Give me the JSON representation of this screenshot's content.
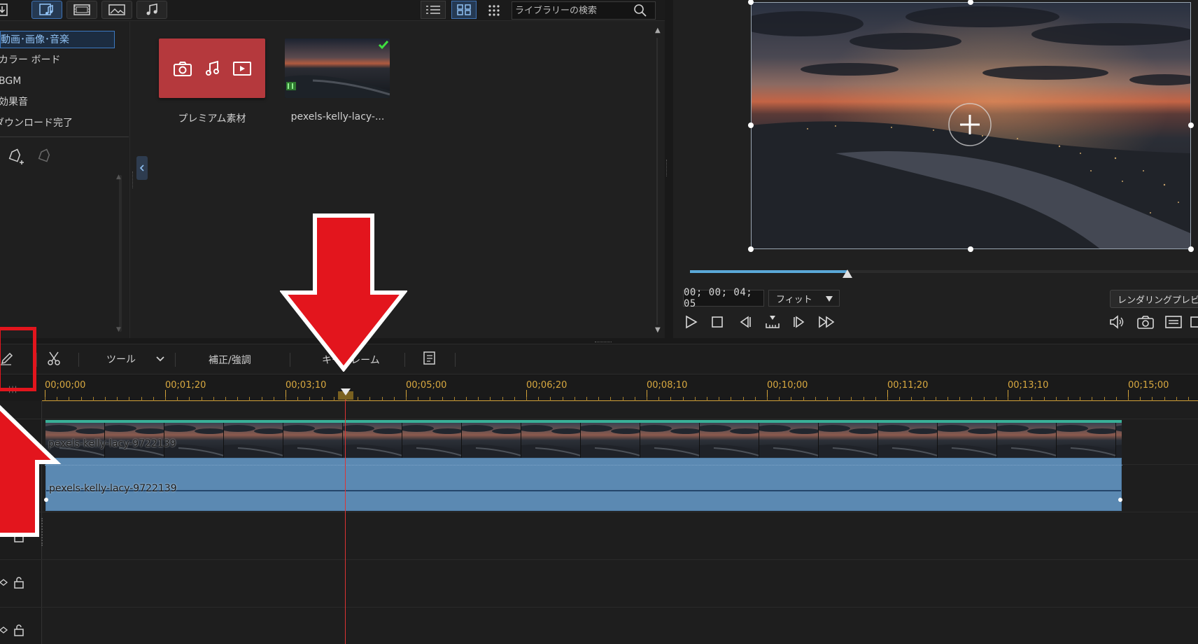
{
  "library": {
    "search_placeholder": "ライブラリーの検索",
    "categories": [
      {
        "label": "動画･画像･音楽",
        "selected": true
      },
      {
        "label": "カラー ボード",
        "selected": false
      },
      {
        "label": "BGM",
        "selected": false
      },
      {
        "label": "効果音",
        "selected": false
      },
      {
        "label": "ダウンロード完了",
        "selected": false
      }
    ],
    "items": [
      {
        "label": "プレミアム素材"
      },
      {
        "label": "pexels-kelly-lacy-..."
      }
    ]
  },
  "preview": {
    "timecode": "00; 00; 04; 05",
    "fit_label": "フィット",
    "render_label": "レンダリングプレビ...",
    "seek_position": 0.31
  },
  "timeline": {
    "tools_label": "ツール",
    "fix_enhance_label": "補正/強調",
    "keyframe_label": "キーフレーム",
    "ruler_ticks": [
      "00;00;00",
      "00;01;20",
      "00;03;10",
      "00;05;00",
      "00;06;20",
      "00;08;10",
      "00;10;00",
      "00;11;20",
      "00;13;10",
      "00;15;00"
    ],
    "video_clip_name": "pexels-kelly-lacy-9722139",
    "audio_clip_name": "pexels-kelly-lacy-9722139"
  },
  "colors": {
    "accent": "#3f73b6",
    "premium_tile": "#b5393d",
    "ruler": "#d9a940",
    "audio_clip": "#5b89b2",
    "video_clip_top": "#39b098",
    "annotation_red": "#e3151d",
    "playhead": "#dd3333"
  }
}
